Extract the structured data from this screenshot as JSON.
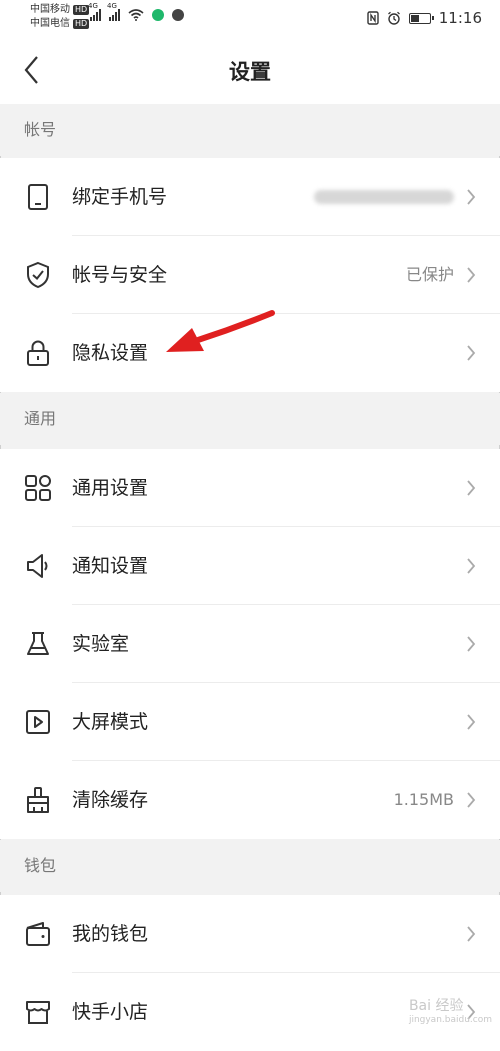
{
  "status_bar": {
    "carrier1": "中国移动",
    "carrier2": "中国电信",
    "hd_badge": "HD",
    "network": "4G",
    "time": "11:16",
    "icons": [
      "nfc-icon",
      "alarm-icon",
      "battery-icon",
      "wifi-icon",
      "signal-icon"
    ]
  },
  "header": {
    "title": "设置",
    "back_icon": "chevron-left-icon"
  },
  "sections": {
    "account": {
      "title": "帐号",
      "items": [
        {
          "label": "绑定手机号",
          "value": "",
          "icon": "phone-icon"
        },
        {
          "label": "帐号与安全",
          "value": "已保护",
          "icon": "shield-icon"
        },
        {
          "label": "隐私设置",
          "value": "",
          "icon": "lock-icon"
        }
      ]
    },
    "general": {
      "title": "通用",
      "items": [
        {
          "label": "通用设置",
          "value": "",
          "icon": "grid-icon"
        },
        {
          "label": "通知设置",
          "value": "",
          "icon": "speaker-icon"
        },
        {
          "label": "实验室",
          "value": "",
          "icon": "flask-icon"
        },
        {
          "label": "大屏模式",
          "value": "",
          "icon": "play-square-icon"
        },
        {
          "label": "清除缓存",
          "value": "1.15MB",
          "icon": "broom-icon"
        }
      ]
    },
    "wallet": {
      "title": "钱包",
      "items": [
        {
          "label": "我的钱包",
          "value": "",
          "icon": "wallet-icon"
        },
        {
          "label": "快手小店",
          "value": "",
          "icon": "shop-icon"
        }
      ]
    }
  },
  "annotation": {
    "arrow_color": "#e02020"
  },
  "watermark": {
    "text": "Bai 经验",
    "sub": "jingyan.baidu.com"
  },
  "colors": {
    "background": "#f2f2f2",
    "row": "#ffffff",
    "arrow": "#e02020"
  }
}
